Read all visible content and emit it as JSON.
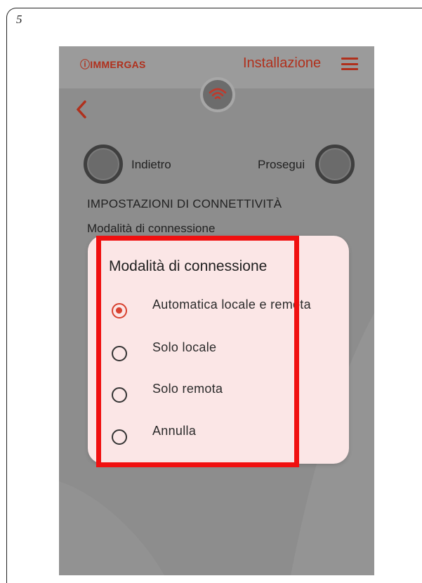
{
  "page": {
    "number": "5"
  },
  "app": {
    "logo": "ⓘIMMERGAS",
    "header_title": "Installazione"
  },
  "wizard": {
    "back_label": "Indietro",
    "next_label": "Prosegui",
    "section_title": "IMPOSTAZIONI DI CONNETTIVITÀ",
    "field_label": "Modalità di connessione"
  },
  "dialog": {
    "title": "Modalità di connessione",
    "options": [
      {
        "label": "Automatica locale e remota",
        "selected": true
      },
      {
        "label": "Solo locale",
        "selected": false
      },
      {
        "label": "Solo remota",
        "selected": false
      },
      {
        "label": "Annulla",
        "selected": false
      }
    ]
  },
  "colors": {
    "brand": "#b0301c",
    "accent": "#d8412f",
    "dialog_bg": "#fbe6e6",
    "highlight": "#f01010",
    "overlay": "#8d8d8d"
  },
  "icons": {
    "menu": "hamburger-icon",
    "back": "chevron-left-icon",
    "wifi": "wifi-icon"
  }
}
